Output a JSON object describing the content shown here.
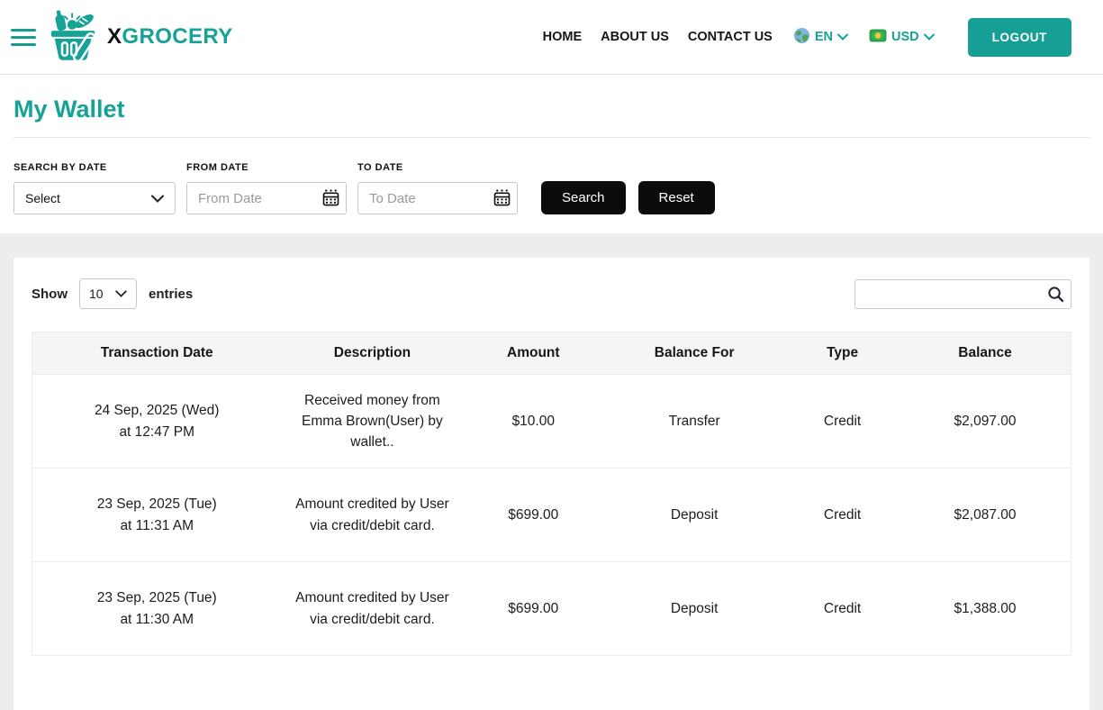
{
  "colors": {
    "accent": "#16a296",
    "dark_button": "#0c0c0c"
  },
  "header": {
    "brand_x": "X",
    "brand_rest": "GROCERY",
    "nav": [
      {
        "label": "HOME"
      },
      {
        "label": "ABOUT US"
      },
      {
        "label": "CONTACT US"
      }
    ],
    "language": {
      "icon": "globe-icon",
      "label": "EN"
    },
    "currency": {
      "icon": "money-icon",
      "label": "USD"
    },
    "logout_label": "LOGOUT"
  },
  "page": {
    "title": "My Wallet"
  },
  "filters": {
    "search_by_date_label": "SEARCH BY DATE",
    "select_value": "Select",
    "from_date_label": "FROM DATE",
    "from_date_placeholder": "From Date",
    "to_date_label": "TO DATE",
    "to_date_placeholder": "To Date",
    "search_button": "Search",
    "reset_button": "Reset"
  },
  "table": {
    "show_label": "Show",
    "entries_value": "10",
    "entries_label": "entries",
    "search_value": "",
    "headers": [
      "Transaction Date",
      "Description",
      "Amount",
      "Balance For",
      "Type",
      "Balance"
    ],
    "rows": [
      {
        "date": "24 Sep, 2025 (Wed)",
        "time": "at 12:47 PM",
        "description": "Received money from Emma Brown(User) by wallet..",
        "amount": "$10.00",
        "balance_for": "Transfer",
        "type": "Credit",
        "balance": "$2,097.00"
      },
      {
        "date": "23 Sep, 2025 (Tue)",
        "time": "at 11:31 AM",
        "description": "Amount credited by User via credit/debit card.",
        "amount": "$699.00",
        "balance_for": "Deposit",
        "type": "Credit",
        "balance": "$2,087.00"
      },
      {
        "date": "23 Sep, 2025 (Tue)",
        "time": "at 11:30 AM",
        "description": "Amount credited by User via credit/debit card.",
        "amount": "$699.00",
        "balance_for": "Deposit",
        "type": "Credit",
        "balance": "$1,388.00"
      }
    ]
  }
}
